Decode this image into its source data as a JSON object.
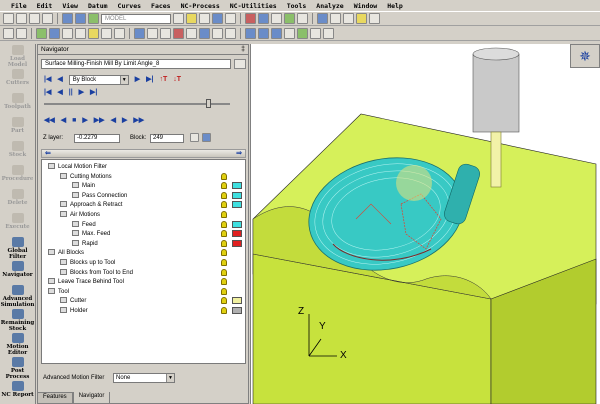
{
  "menu": [
    "File",
    "Edit",
    "View",
    "Datum",
    "Curves",
    "Faces",
    "NC-Process",
    "NC-Utilities",
    "Tools",
    "Analyze",
    "Window",
    "Help"
  ],
  "toolbar": {
    "model_select": "MODEL"
  },
  "left_sidebar": [
    {
      "label": "Load Model",
      "active": false
    },
    {
      "label": "Cutters",
      "active": false
    },
    {
      "label": "Toolpath",
      "active": false
    },
    {
      "label": "Part",
      "active": false
    },
    {
      "label": "Stock",
      "active": false
    },
    {
      "label": "Procedure",
      "active": false
    },
    {
      "label": "Delete",
      "active": false
    },
    {
      "label": "Execute",
      "active": false
    },
    {
      "label": "Global Filter",
      "active": true
    },
    {
      "label": "Navigator",
      "active": true
    },
    {
      "label": "Advanced Simulation",
      "active": true
    },
    {
      "label": "Remaining Stock",
      "active": true
    },
    {
      "label": "Motion Editor",
      "active": true
    },
    {
      "label": "Post Process",
      "active": true
    },
    {
      "label": "NC Report",
      "active": true
    }
  ],
  "navigator": {
    "title": "Navigator",
    "pin": "‡",
    "operation": "Surface Milling-Finish Mill By Limit Angle_8",
    "mode": "By Block",
    "z_layer_label": "Z layer:",
    "z_layer_value": "-0.2279",
    "block_label": "Block:",
    "block_value": "249"
  },
  "tree": [
    {
      "label": "Local Motion Filter",
      "indent": 0,
      "bulb": false,
      "color": null
    },
    {
      "label": "Cutting Motions",
      "indent": 1,
      "bulb": true,
      "color": null
    },
    {
      "label": "Main",
      "indent": 2,
      "bulb": true,
      "color": "#40e0e0"
    },
    {
      "label": "Pass Connection",
      "indent": 2,
      "bulb": true,
      "color": "#40e0e0"
    },
    {
      "label": "Approach & Retract",
      "indent": 1,
      "bulb": true,
      "color": "#40e0e0"
    },
    {
      "label": "Air Motions",
      "indent": 1,
      "bulb": true,
      "color": null
    },
    {
      "label": "Feed",
      "indent": 2,
      "bulb": true,
      "color": "#40e0e0"
    },
    {
      "label": "Max. Feed",
      "indent": 2,
      "bulb": true,
      "color": "#e02020"
    },
    {
      "label": "Rapid",
      "indent": 2,
      "bulb": true,
      "color": "#e02020"
    },
    {
      "label": "All Blocks",
      "indent": 0,
      "bulb": true,
      "color": null
    },
    {
      "label": "Blocks up to Tool",
      "indent": 1,
      "bulb": true,
      "color": null
    },
    {
      "label": "Blocks from Tool to End",
      "indent": 1,
      "bulb": true,
      "color": null
    },
    {
      "label": "Leave Trace Behind Tool",
      "indent": 0,
      "bulb": true,
      "color": null
    },
    {
      "label": "Tool",
      "indent": 0,
      "bulb": true,
      "color": null
    },
    {
      "label": "Cutter",
      "indent": 1,
      "bulb": true,
      "color": "#f0f0a0"
    },
    {
      "label": "Holder",
      "indent": 1,
      "bulb": true,
      "color": "#b0b0b0"
    }
  ],
  "advanced_filter": {
    "label": "Advanced Motion Filter",
    "value": "None"
  },
  "tabs": [
    "Features",
    "Navigator"
  ],
  "viewport": {
    "axis_x": "X",
    "axis_y": "Y",
    "axis_z": "Z"
  }
}
